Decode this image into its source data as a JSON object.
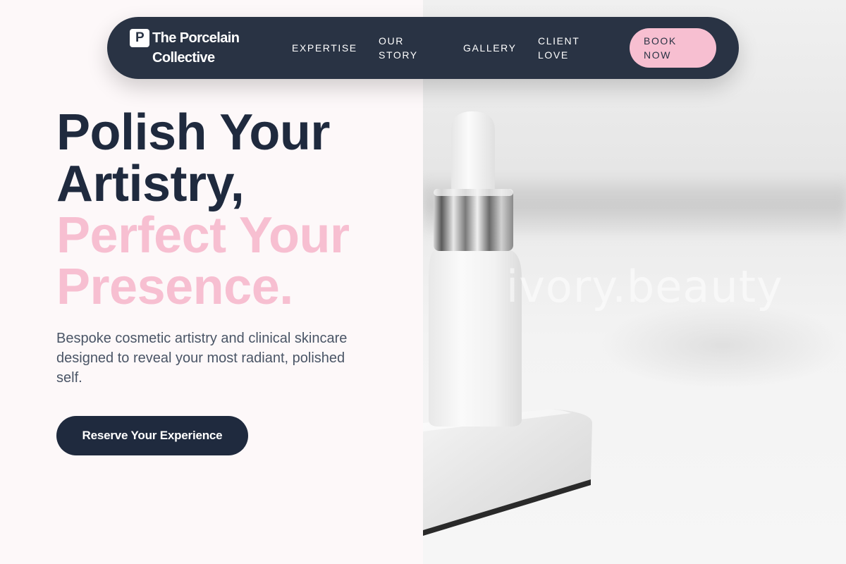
{
  "brand": {
    "mark": "P",
    "name": "The Porcelain Collective"
  },
  "nav": {
    "links": [
      "Expertise",
      "Our Story",
      "Gallery",
      "Client Love"
    ],
    "cta": "Book Now"
  },
  "hero": {
    "title_line1": "Polish Your",
    "title_line2": "Artistry,",
    "title_accent1": "Perfect Your",
    "title_accent2": "Presence.",
    "subtitle": "Bespoke cosmetic artistry and clinical skincare designed to reveal your most radiant, polished self.",
    "cta": "Reserve Your Experience"
  },
  "photo": {
    "watermark": "ivory.beauty"
  },
  "colors": {
    "navy": "#1f2a3e",
    "nav_bg": "#293344",
    "pink": "#f7bfd1",
    "page_bg": "#fdf8f9"
  }
}
